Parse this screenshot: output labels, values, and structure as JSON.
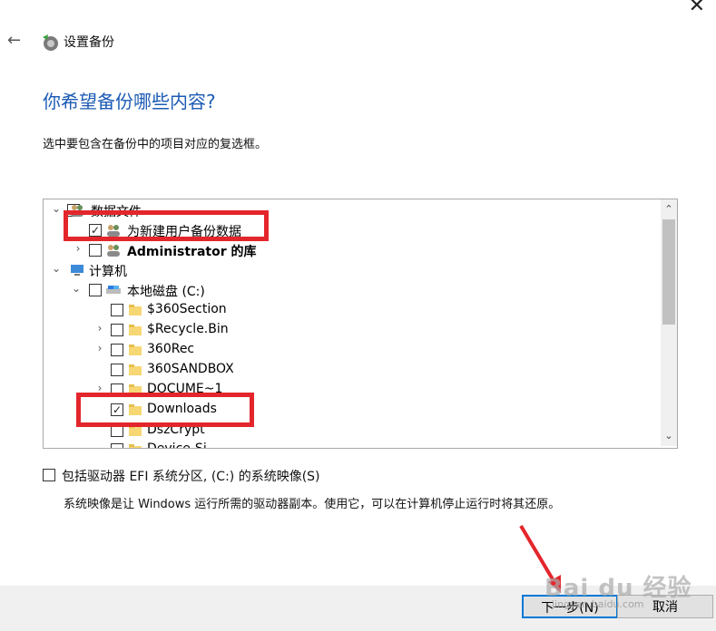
{
  "window": {
    "close_glyph": "✕",
    "back_glyph": "←",
    "title": "设置备份"
  },
  "page": {
    "heading": "你希望备份哪些内容?",
    "instruction": "选中要包含在备份中的项目对应的复选框。"
  },
  "tree": {
    "items": [
      {
        "label": "数据文件",
        "expanded": true,
        "checked": false,
        "icon": "users-icon"
      },
      {
        "label": "为新建用户备份数据",
        "checked": true,
        "icon": "users-icon"
      },
      {
        "label": "Administrator 的库",
        "checked": false,
        "icon": "users-icon",
        "collapsed": true
      },
      {
        "label": "计算机",
        "expanded": true,
        "icon": "computer-icon"
      },
      {
        "label": "本地磁盘 (C:)",
        "expanded": true,
        "checked": false,
        "icon": "drive-icon"
      },
      {
        "label": "$360Section",
        "checked": false,
        "icon": "folder-icon"
      },
      {
        "label": "$Recycle.Bin",
        "checked": false,
        "icon": "folder-icon",
        "collapsed": true
      },
      {
        "label": "360Rec",
        "checked": false,
        "icon": "folder-icon",
        "collapsed": true
      },
      {
        "label": "360SANDBOX",
        "checked": false,
        "icon": "folder-icon"
      },
      {
        "label": "DOCUME~1",
        "checked": false,
        "icon": "folder-icon",
        "collapsed": true
      },
      {
        "label": "Downloads",
        "checked": true,
        "icon": "folder-icon"
      },
      {
        "label": "DszCrypt",
        "checked": false,
        "icon": "folder-icon"
      },
      {
        "label": "Device-Si",
        "checked": false,
        "icon": "folder-icon"
      }
    ]
  },
  "system_image": {
    "label": "包括驱动器 EFI 系统分区, (C:) 的系统映像(S)",
    "description": "系统映像是让 Windows 运行所需的驱动器副本。使用它，可以在计算机停止运行时将其还原。",
    "checked": false
  },
  "footer": {
    "next_label": "下一步(N)",
    "cancel_label": "取消"
  },
  "watermark": {
    "brand": "Bai du 经验",
    "url": "jingyan.baidu.com"
  },
  "colors": {
    "heading": "#1c5bb5",
    "annotation": "#e3262c",
    "primary_button_border": "#0078d7"
  }
}
